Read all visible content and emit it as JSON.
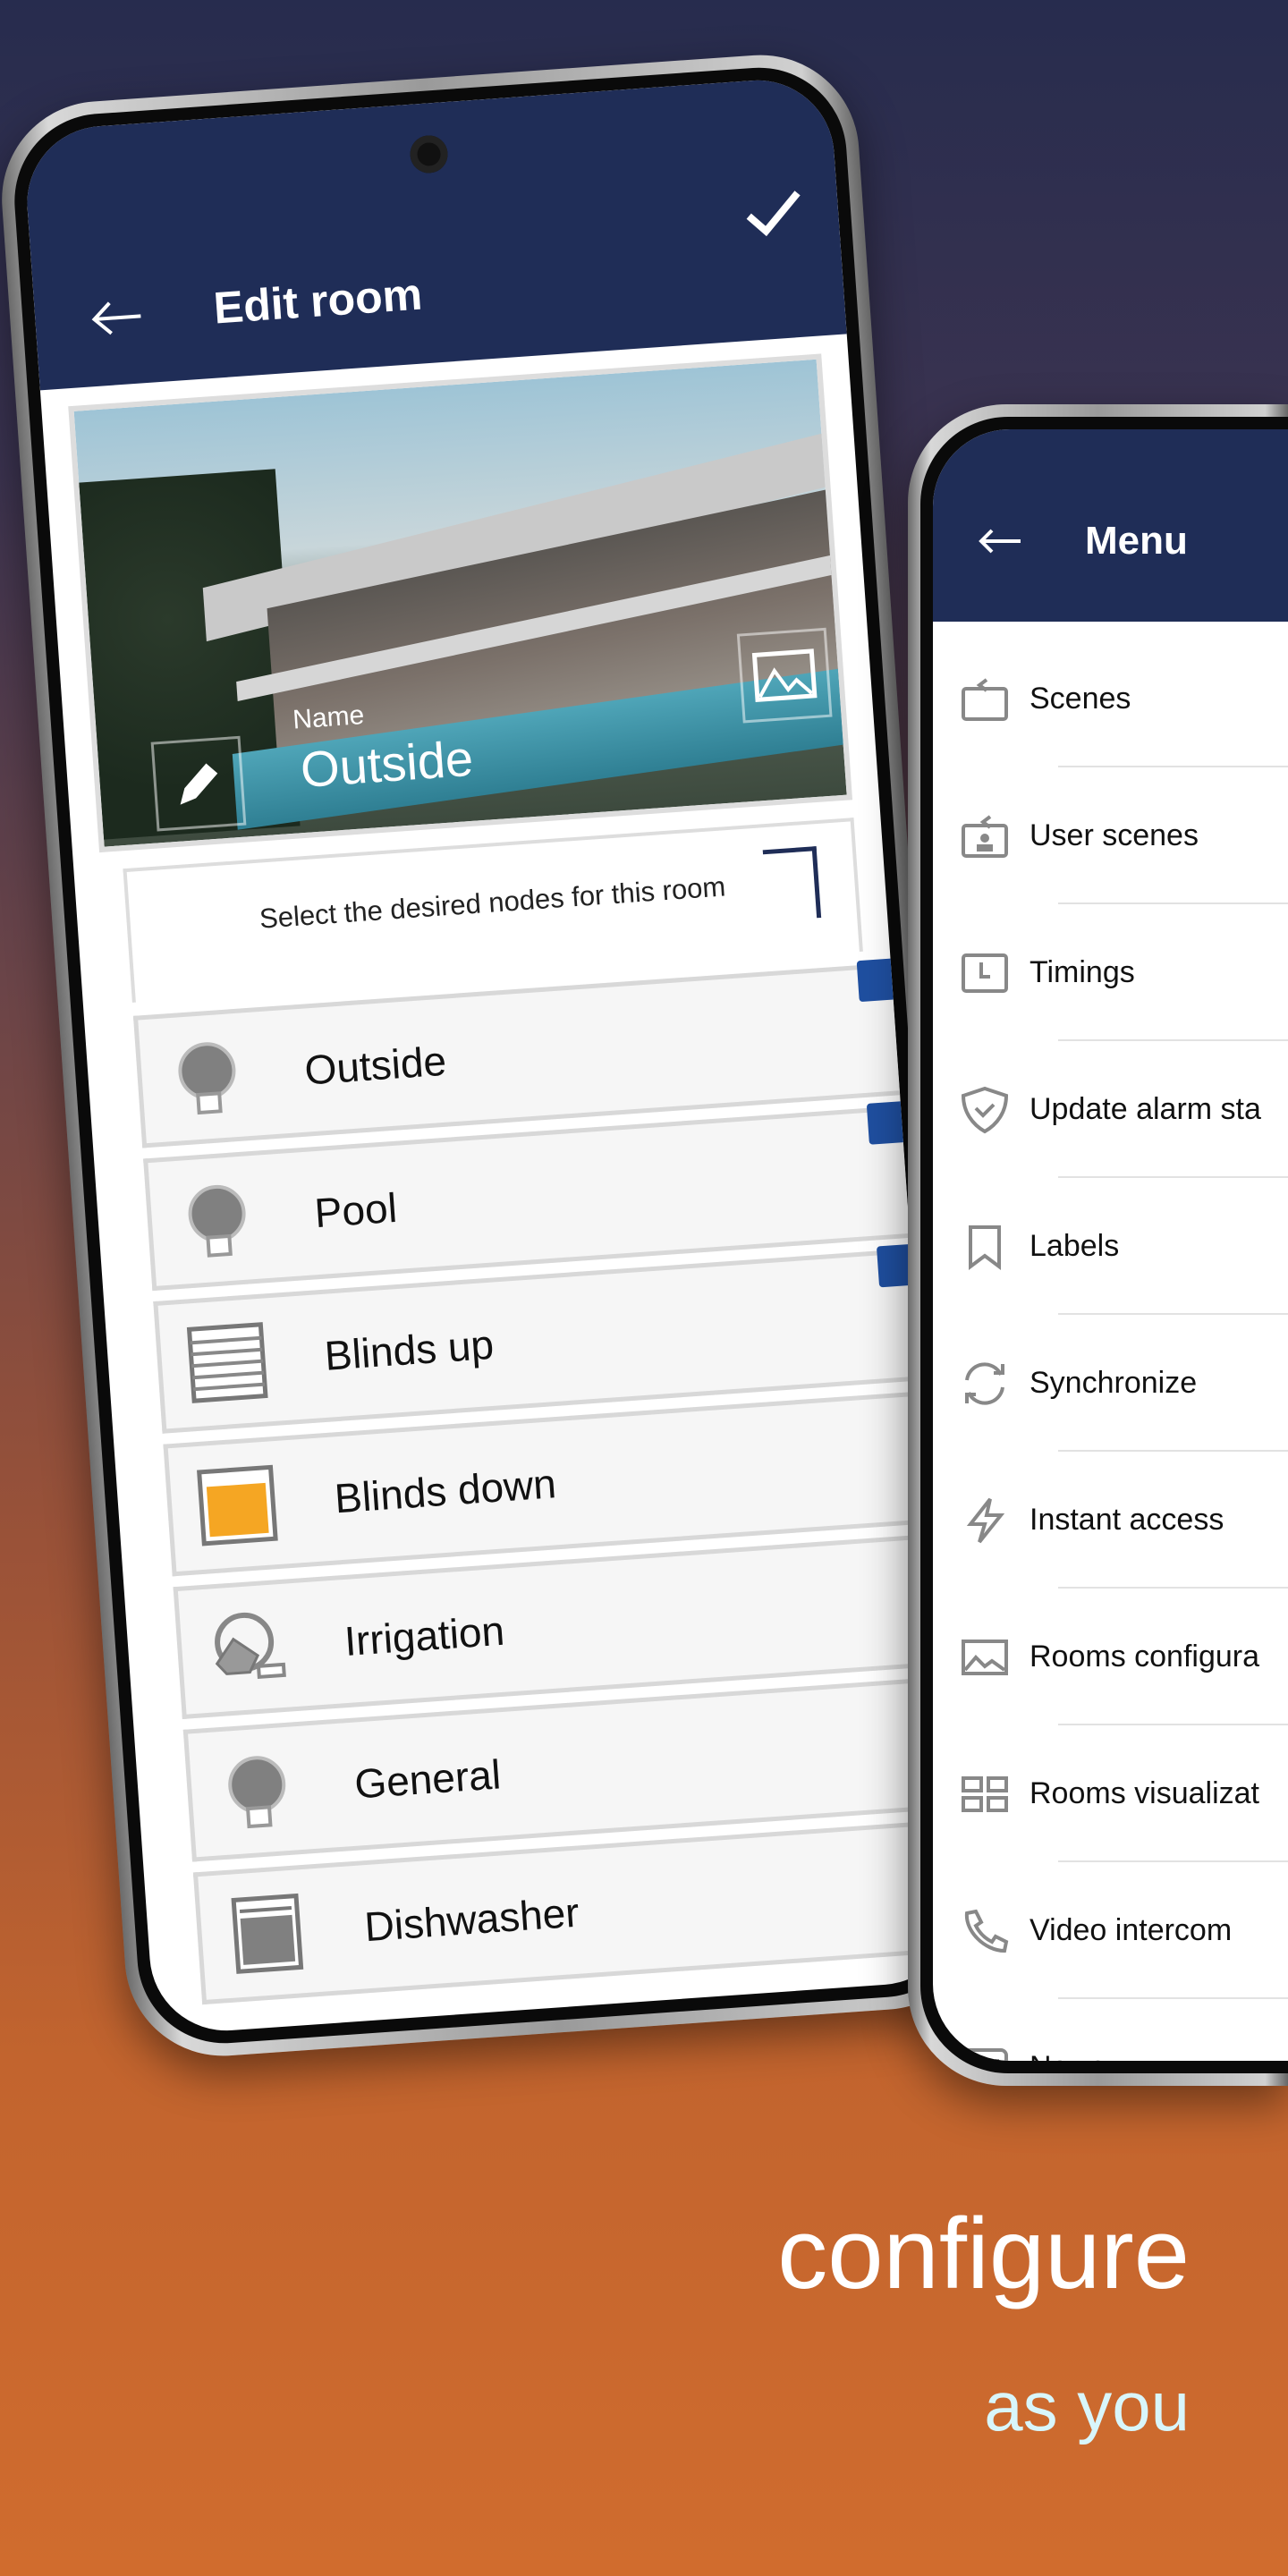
{
  "edit_room": {
    "title": "Edit room",
    "back_icon": "arrow-left-icon",
    "confirm_icon": "check-icon",
    "photo": {
      "name_label": "Name",
      "name_value": "Outside",
      "edit_icon": "pencil-icon",
      "change_image_icon": "image-icon"
    },
    "instruction": "Select the desired nodes for this room",
    "nodes": [
      {
        "label": "Outside",
        "icon": "bulb-icon",
        "checked": true
      },
      {
        "label": "Pool",
        "icon": "bulb-icon",
        "checked": true
      },
      {
        "label": "Blinds up",
        "icon": "blinds-up-icon",
        "checked": true
      },
      {
        "label": "Blinds down",
        "icon": "blinds-down-icon"
      },
      {
        "label": "Irrigation",
        "icon": "watering-can-icon"
      },
      {
        "label": "General",
        "icon": "bulb-icon"
      },
      {
        "label": "Dishwasher",
        "icon": "dishwasher-icon"
      }
    ]
  },
  "menu": {
    "title": "Menu",
    "back_icon": "arrow-left-icon",
    "items": [
      {
        "label": "Scenes",
        "icon": "scenes-icon"
      },
      {
        "label": "User scenes",
        "icon": "user-scenes-icon"
      },
      {
        "label": "Timings",
        "icon": "clock-icon"
      },
      {
        "label": "Update alarm sta",
        "icon": "shield-check-icon"
      },
      {
        "label": "Labels",
        "icon": "bookmark-icon"
      },
      {
        "label": "Synchronize",
        "icon": "sync-icon"
      },
      {
        "label": "Instant access",
        "icon": "lightning-icon"
      },
      {
        "label": "Rooms configura",
        "icon": "image-icon"
      },
      {
        "label": "Rooms visualizat",
        "icon": "grid-icon"
      },
      {
        "label": "Video intercom",
        "icon": "phone-icon"
      },
      {
        "label": "News",
        "icon": "news-icon"
      }
    ]
  },
  "tagline": {
    "line1": "configure",
    "line2": "as you"
  },
  "colors": {
    "header": "#1f2d57",
    "checkbox": "#1f4fa0",
    "blinds_down": "#f5a623",
    "tagline2": "#d8f6fb"
  }
}
